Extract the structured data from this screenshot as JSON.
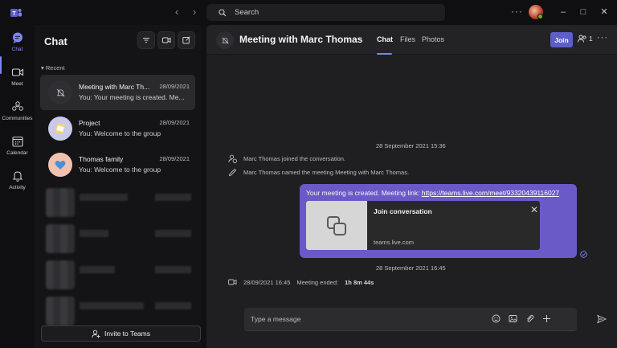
{
  "titlebar": {
    "search_placeholder": "Search",
    "nav_back": "‹",
    "nav_forward": "›",
    "more": "···",
    "minimize": "–",
    "maximize": "□",
    "close": "✕"
  },
  "rail": {
    "items": [
      {
        "label": "Chat",
        "icon": "chat-icon"
      },
      {
        "label": "Meet",
        "icon": "video-icon"
      },
      {
        "label": "Communities",
        "icon": "communities-icon"
      },
      {
        "label": "Calendar",
        "icon": "calendar-icon"
      },
      {
        "label": "Activity",
        "icon": "bell-icon"
      }
    ],
    "accent": "#7f85f5"
  },
  "chatlist": {
    "title": "Chat",
    "recent_label": "Recent",
    "items": [
      {
        "name": "Meeting with Marc Th...",
        "date": "28/09/2021",
        "preview": "You: Your meeting is created. Me..."
      },
      {
        "name": "Project",
        "date": "28/09/2021",
        "preview": "You: Welcome to the group"
      },
      {
        "name": "Thomas family",
        "date": "28/09/2021",
        "preview": "You: Welcome to the group"
      }
    ],
    "invite_label": "Invite to Teams"
  },
  "conversation": {
    "title": "Meeting with Marc Thomas",
    "tabs": [
      "Chat",
      "Files",
      "Photos"
    ],
    "join_label": "Join",
    "participants_count": "1",
    "more": "···",
    "date_separator_1": "28 September 2021 15:36",
    "events": [
      {
        "text": "Marc Thomas joined the conversation."
      },
      {
        "text": "Marc Thomas named the meeting Meeting with Marc Thomas."
      }
    ],
    "message": {
      "text": "Your meeting is created. Meeting link: ",
      "link": "https://teams.live.com/meet/93320439116027",
      "card_title": "Join conversation",
      "card_domain": "teams.live.com",
      "card_close": "✕"
    },
    "date_separator_2": "28 September 2021 16:45",
    "ended_event": {
      "timestamp": "28/09/2021 16:45",
      "label": "Meeting ended:",
      "duration": "1h 8m 44s"
    },
    "composer_placeholder": "Type a message",
    "bubble_color": "#6a5ac8",
    "join_color": "#5b5fc7"
  }
}
